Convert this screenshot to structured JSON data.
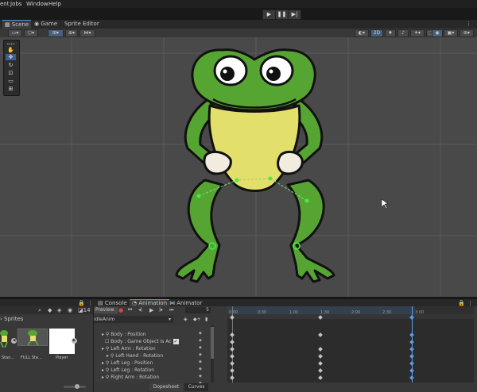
{
  "menu": [
    "ent",
    "Jobs",
    "Window",
    "Help"
  ],
  "play": {
    "play": "▶",
    "pause": "❚❚",
    "step": "▶|"
  },
  "scene_tabs": {
    "scene": "Scene",
    "game": "Game",
    "sprite_editor": "Sprite Editor"
  },
  "toolbar": {
    "two_d": "2D",
    "dots": "⋮"
  },
  "sprites": {
    "title": "Sprites",
    "count": "14",
    "items": [
      {
        "label": "Stan..."
      },
      {
        "label": "FULL Sta..."
      },
      {
        "label": "Player"
      }
    ]
  },
  "bottom_tabs": {
    "console": "Console",
    "animation": "Animation",
    "animator": "Animator"
  },
  "animation": {
    "preview": "Preview",
    "frame": "5",
    "clip": "idleAnim",
    "ruler": [
      "0:00",
      "0:30",
      "1:00",
      "1:30",
      "2:00",
      "2:30",
      "3:00"
    ],
    "properties": [
      "Body : Position",
      "Body : Game Object Is Ac",
      "Left Arm : Rotation",
      "Left Hand : Rotation",
      "Left Leg : Position",
      "Left Leg : Rotation",
      "Right Arm : Rotation"
    ],
    "dopesheet": "Dopesheet",
    "curves": "Curves"
  },
  "colors": {
    "frog_green": "#56a532",
    "belly": "#e3df6b",
    "accent": "#5c9ee6"
  }
}
